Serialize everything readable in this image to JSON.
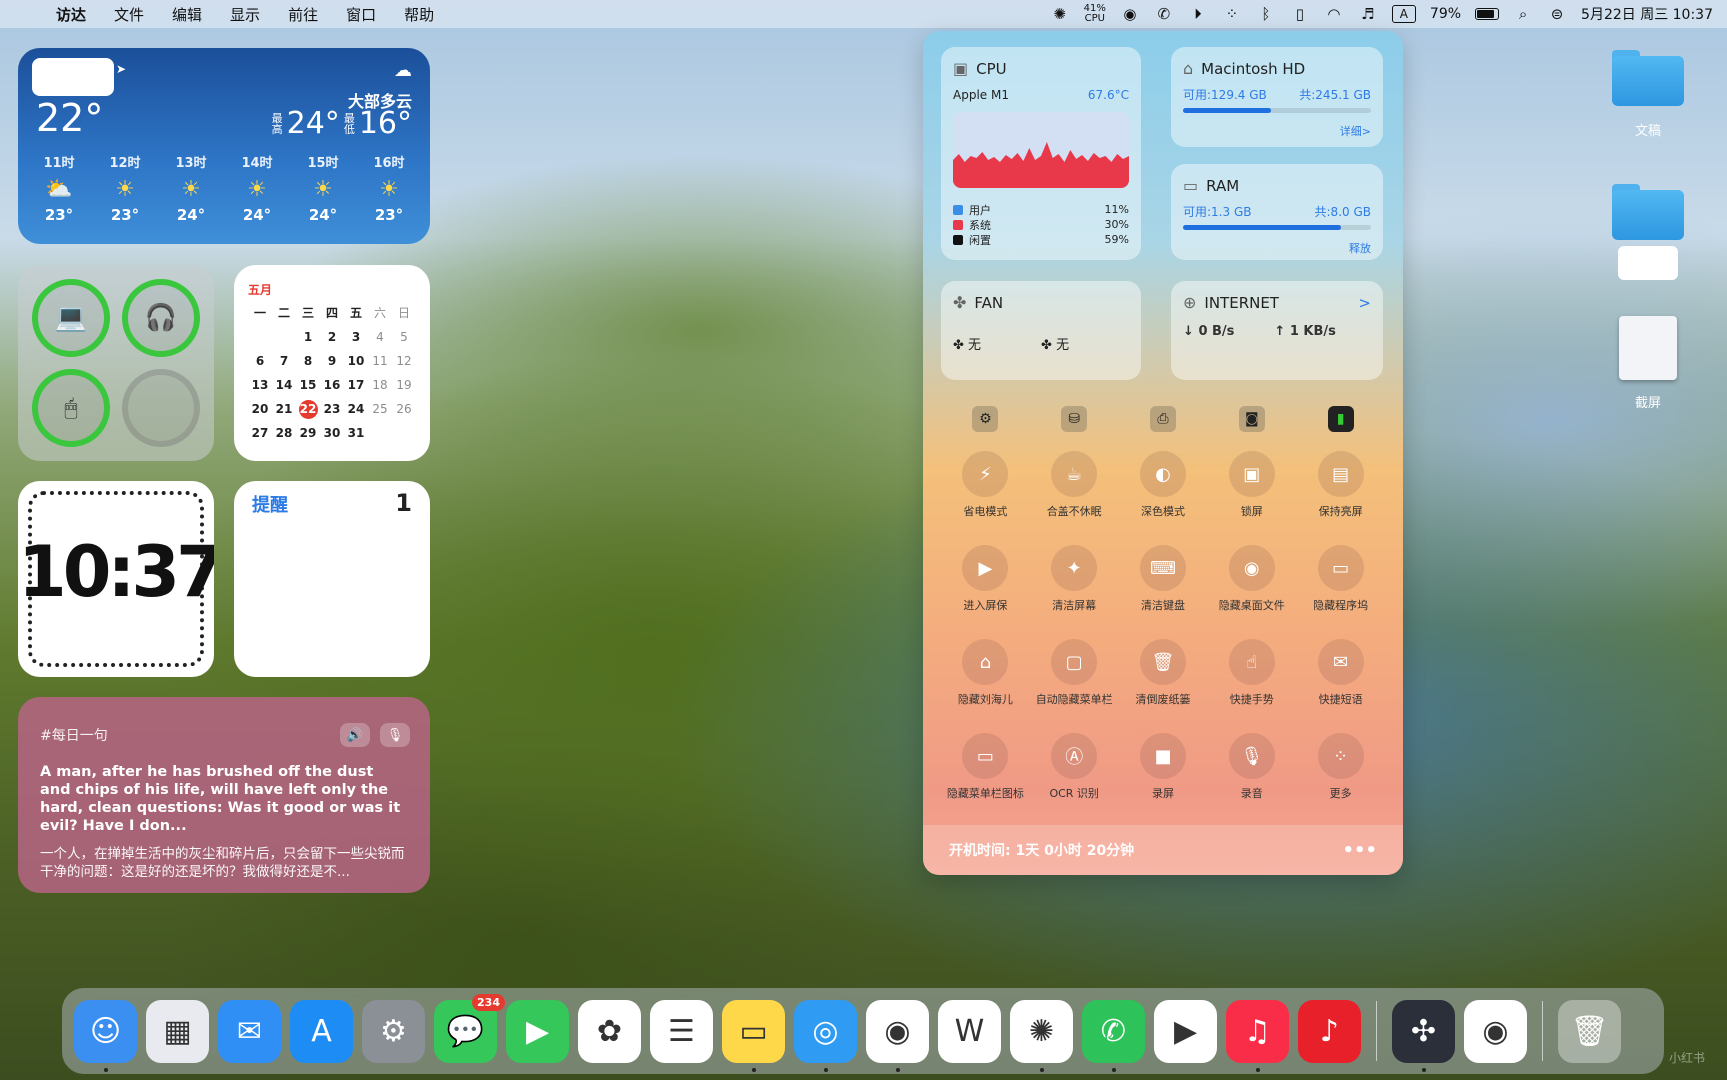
{
  "menubar": {
    "apple": "",
    "items": [
      "访达",
      "文件",
      "编辑",
      "显示",
      "前往",
      "窗口",
      "帮助"
    ],
    "cpu_percent": "41%",
    "cpu_label": "CPU",
    "input_source": "A",
    "battery": "79%",
    "battery_level": 0.79,
    "datetime": "5月22日 周三  10:37"
  },
  "weather": {
    "temp": "22°",
    "condition": "大部多云",
    "hi_label": "最高",
    "hi": "24°",
    "lo_label": "最低",
    "lo": "16°",
    "hours": [
      {
        "time": "11时",
        "icon": "cloud-sun-icon",
        "temp": "23°"
      },
      {
        "time": "12时",
        "icon": "sun-icon",
        "temp": "23°"
      },
      {
        "time": "13时",
        "icon": "sun-icon",
        "temp": "24°"
      },
      {
        "time": "14时",
        "icon": "sun-icon",
        "temp": "24°"
      },
      {
        "time": "15时",
        "icon": "sun-icon",
        "temp": "24°"
      },
      {
        "time": "16时",
        "icon": "sun-icon",
        "temp": "23°"
      }
    ]
  },
  "batteries": [
    {
      "device": "laptop-icon",
      "level": 1.0
    },
    {
      "device": "airpods-icon",
      "level": 1.0
    },
    {
      "device": "mouse-icon",
      "level": 1.0
    },
    {
      "device": "empty",
      "level": 0
    }
  ],
  "calendar": {
    "month": "五月",
    "weekdays": [
      "一",
      "二",
      "三",
      "四",
      "五",
      "六",
      "日"
    ],
    "rows": [
      [
        "",
        "",
        "1",
        "2",
        "3",
        "4",
        "5"
      ],
      [
        "6",
        "7",
        "8",
        "9",
        "10",
        "11",
        "12"
      ],
      [
        "13",
        "14",
        "15",
        "16",
        "17",
        "18",
        "19"
      ],
      [
        "20",
        "21",
        "22",
        "23",
        "24",
        "25",
        "26"
      ],
      [
        "27",
        "28",
        "29",
        "30",
        "31",
        "",
        ""
      ]
    ],
    "today": "22"
  },
  "clock": {
    "time": "10:37"
  },
  "reminder": {
    "title": "提醒",
    "count": "1"
  },
  "quote": {
    "tag": "#每日一句",
    "en": "A man, after he has brushed off the dust and chips of his life, will have left only the hard, clean questions: Was it good or was it evil? Have I don...",
    "zh": "一个人，在掸掉生活中的灰尘和碎片后，只会留下一些尖锐而干净的问题：这是好的还是坏的？我做得好还是不..."
  },
  "panel": {
    "cpu": {
      "title": "CPU",
      "chip": "Apple M1",
      "temp": "67.6°C",
      "legend": [
        {
          "label": "用户",
          "value": "11%",
          "color": "#3a8ee6"
        },
        {
          "label": "系统",
          "value": "30%",
          "color": "#e8394a"
        },
        {
          "label": "闲置",
          "value": "59%",
          "color": "#111111"
        }
      ]
    },
    "disk": {
      "title": "Macintosh HD",
      "free": "可用:129.4 GB",
      "total": "共:245.1 GB",
      "used_fraction": 0.47,
      "more": "详细>"
    },
    "ram": {
      "title": "RAM",
      "free": "可用:1.3 GB",
      "total": "共:8.0 GB",
      "used_fraction": 0.84,
      "more": "释放"
    },
    "fan": {
      "title": "FAN",
      "fan1": "无",
      "fan2": "无"
    },
    "internet": {
      "title": "INTERNET",
      "go": ">",
      "down": "0 B/s",
      "up": "1 KB/s"
    },
    "apps": [
      "settings-app-icon",
      "disk-utility-icon",
      "printer-icon",
      "camera-icon",
      "terminal-icon"
    ],
    "tools": [
      {
        "label": "省电模式",
        "icon": "bolt-icon"
      },
      {
        "label": "合盖不休眠",
        "icon": "cup-icon"
      },
      {
        "label": "深色模式",
        "icon": "half-circle-icon"
      },
      {
        "label": "锁屏",
        "icon": "monitor-lock-icon"
      },
      {
        "label": "保持亮屏",
        "icon": "monitor-icon"
      },
      {
        "label": "进入屏保",
        "icon": "play-screen-icon"
      },
      {
        "label": "清洁屏幕",
        "icon": "clean-screen-icon"
      },
      {
        "label": "清洁键盘",
        "icon": "keyboard-icon"
      },
      {
        "label": "隐藏桌面文件",
        "icon": "eye-icon"
      },
      {
        "label": "隐藏程序坞",
        "icon": "dock-icon"
      },
      {
        "label": "隐藏刘海儿",
        "icon": "laptop-icon"
      },
      {
        "label": "自动隐藏菜单栏",
        "icon": "window-icon"
      },
      {
        "label": "清倒废纸篓",
        "icon": "trash-icon"
      },
      {
        "label": "快捷手势",
        "icon": "hand-icon"
      },
      {
        "label": "快捷短语",
        "icon": "message-icon"
      },
      {
        "label": "隐藏菜单栏图标",
        "icon": "menubar-icon"
      },
      {
        "label": "OCR 识别",
        "icon": "ocr-icon"
      },
      {
        "label": "录屏",
        "icon": "video-icon"
      },
      {
        "label": "录音",
        "icon": "mic-icon"
      },
      {
        "label": "更多",
        "icon": "grid-icon"
      }
    ],
    "uptime": "开机时间:  1天 0小时 20分钟",
    "menu_dots": "•••"
  },
  "desktop": {
    "icons": [
      {
        "label": "文稿",
        "type": "folder"
      },
      {
        "label": "",
        "type": "folder"
      },
      {
        "label": "截屏",
        "type": "screenshot"
      }
    ]
  },
  "dock": {
    "apps": [
      {
        "name": "finder",
        "bg": "#3b8ff0",
        "glyph": "☺",
        "running": true
      },
      {
        "name": "launchpad",
        "bg": "#e8eaef",
        "glyph": "▦",
        "running": false
      },
      {
        "name": "mail",
        "bg": "#2f8ff5",
        "glyph": "✉",
        "running": false
      },
      {
        "name": "app-store",
        "bg": "#1d8cf5",
        "glyph": "A",
        "running": false
      },
      {
        "name": "system-settings",
        "bg": "#8b8f96",
        "glyph": "⚙",
        "running": false
      },
      {
        "name": "messages",
        "bg": "#35c759",
        "glyph": "💬",
        "running": false,
        "badge": "234"
      },
      {
        "name": "facetime",
        "bg": "#35c759",
        "glyph": "▶",
        "running": false
      },
      {
        "name": "photos",
        "bg": "#ffffff",
        "glyph": "✿",
        "running": false
      },
      {
        "name": "reminders",
        "bg": "#ffffff",
        "glyph": "☰",
        "running": false
      },
      {
        "name": "notes",
        "bg": "#ffd84a",
        "glyph": "▭",
        "running": true
      },
      {
        "name": "safari",
        "bg": "#2f9bf2",
        "glyph": "◎",
        "running": true
      },
      {
        "name": "chrome",
        "bg": "#ffffff",
        "glyph": "◉",
        "running": true
      },
      {
        "name": "wps",
        "bg": "#ffffff",
        "glyph": "W",
        "running": false
      },
      {
        "name": "chatgpt",
        "bg": "#ffffff",
        "glyph": "✺",
        "running": true
      },
      {
        "name": "wechat",
        "bg": "#2ec25a",
        "glyph": "✆",
        "running": true
      },
      {
        "name": "youtube",
        "bg": "#ffffff",
        "glyph": "▶",
        "running": false
      },
      {
        "name": "music",
        "bg": "#fa2d48",
        "glyph": "♫",
        "running": true
      },
      {
        "name": "netease-music",
        "bg": "#e8202a",
        "glyph": "♪",
        "running": false
      },
      {
        "name": "davinci-resolve",
        "bg": "#2a2f3a",
        "glyph": "✣",
        "running": true
      },
      {
        "name": "chrome-2",
        "bg": "#ffffff",
        "glyph": "◉",
        "running": false
      },
      {
        "name": "trash",
        "bg": "rgba(255,255,255,0.35)",
        "glyph": "🗑",
        "running": false
      }
    ]
  },
  "watermark": "小红书"
}
